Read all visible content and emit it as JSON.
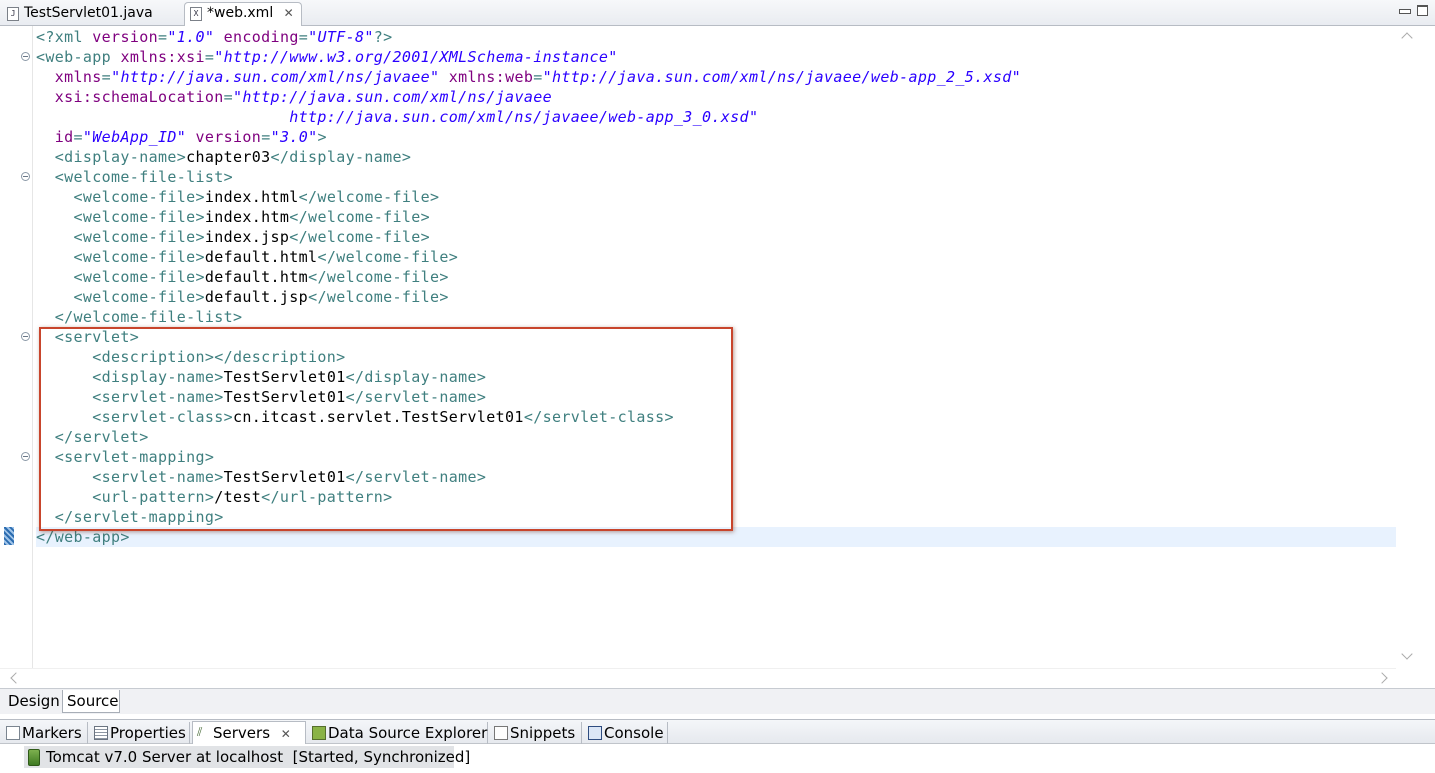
{
  "editor_tabs": [
    {
      "label": "TestServlet01.java",
      "icon": "java-file-icon",
      "active": false
    },
    {
      "label": "*web.xml",
      "icon": "xml-file-icon",
      "active": true,
      "close": "✕"
    }
  ],
  "code_lines": [
    [
      [
        "t",
        "<?xml "
      ],
      [
        "a",
        "version"
      ],
      [
        "t",
        "="
      ],
      [
        "v",
        "\"1.0\""
      ],
      [
        "t",
        " "
      ],
      [
        "a",
        "encoding"
      ],
      [
        "t",
        "="
      ],
      [
        "v",
        "\"UTF-8\""
      ],
      [
        "t",
        "?>"
      ]
    ],
    [
      [
        "t",
        "<web-app "
      ],
      [
        "a",
        "xmlns:xsi"
      ],
      [
        "t",
        "="
      ],
      [
        "v",
        "\"http://www.w3.org/2001/XMLSchema-instance\""
      ]
    ],
    [
      [
        "t",
        "  "
      ],
      [
        "a",
        "xmlns"
      ],
      [
        "t",
        "="
      ],
      [
        "v",
        "\"http://java.sun.com/xml/ns/javaee\""
      ],
      [
        "t",
        " "
      ],
      [
        "a",
        "xmlns:web"
      ],
      [
        "t",
        "="
      ],
      [
        "v",
        "\"http://java.sun.com/xml/ns/javaee/web-app_2_5.xsd\""
      ]
    ],
    [
      [
        "t",
        "  "
      ],
      [
        "a",
        "xsi:schemaLocation"
      ],
      [
        "t",
        "="
      ],
      [
        "v",
        "\"http://java.sun.com/xml/ns/javaee"
      ]
    ],
    [
      [
        "t",
        "                           "
      ],
      [
        "v",
        "http://java.sun.com/xml/ns/javaee/web-app_3_0.xsd\""
      ]
    ],
    [
      [
        "t",
        "  "
      ],
      [
        "a",
        "id"
      ],
      [
        "t",
        "="
      ],
      [
        "v",
        "\"WebApp_ID\""
      ],
      [
        "t",
        " "
      ],
      [
        "a",
        "version"
      ],
      [
        "t",
        "="
      ],
      [
        "v",
        "\"3.0\""
      ],
      [
        "t",
        ">"
      ]
    ],
    [
      [
        "t",
        "  <display-name>"
      ],
      [
        "x",
        "chapter03"
      ],
      [
        "t",
        "</display-name>"
      ]
    ],
    [
      [
        "t",
        "  <welcome-file-list>"
      ]
    ],
    [
      [
        "t",
        "    <welcome-file>"
      ],
      [
        "x",
        "index.html"
      ],
      [
        "t",
        "</welcome-file>"
      ]
    ],
    [
      [
        "t",
        "    <welcome-file>"
      ],
      [
        "x",
        "index.htm"
      ],
      [
        "t",
        "</welcome-file>"
      ]
    ],
    [
      [
        "t",
        "    <welcome-file>"
      ],
      [
        "x",
        "index.jsp"
      ],
      [
        "t",
        "</welcome-file>"
      ]
    ],
    [
      [
        "t",
        "    <welcome-file>"
      ],
      [
        "x",
        "default.html"
      ],
      [
        "t",
        "</welcome-file>"
      ]
    ],
    [
      [
        "t",
        "    <welcome-file>"
      ],
      [
        "x",
        "default.htm"
      ],
      [
        "t",
        "</welcome-file>"
      ]
    ],
    [
      [
        "t",
        "    <welcome-file>"
      ],
      [
        "x",
        "default.jsp"
      ],
      [
        "t",
        "</welcome-file>"
      ]
    ],
    [
      [
        "t",
        "  </welcome-file-list>"
      ]
    ],
    [
      [
        "t",
        "  <servlet>"
      ]
    ],
    [
      [
        "t",
        "      <description></description>"
      ]
    ],
    [
      [
        "t",
        "      <display-name>"
      ],
      [
        "x",
        "TestServlet01"
      ],
      [
        "t",
        "</display-name>"
      ]
    ],
    [
      [
        "t",
        "      <servlet-name>"
      ],
      [
        "x",
        "TestServlet01"
      ],
      [
        "t",
        "</servlet-name>"
      ]
    ],
    [
      [
        "t",
        "      <servlet-class>"
      ],
      [
        "x",
        "cn.itcast.servlet.TestServlet01"
      ],
      [
        "t",
        "</servlet-class>"
      ]
    ],
    [
      [
        "t",
        "  </servlet>"
      ]
    ],
    [
      [
        "t",
        "  <servlet-mapping>"
      ]
    ],
    [
      [
        "t",
        "      <servlet-name>"
      ],
      [
        "x",
        "TestServlet01"
      ],
      [
        "t",
        "</servlet-name>"
      ]
    ],
    [
      [
        "t",
        "      <url-pattern>"
      ],
      [
        "x",
        "/test"
      ],
      [
        "t",
        "</url-pattern>"
      ]
    ],
    [
      [
        "t",
        "  </servlet-mapping>"
      ]
    ],
    [
      [
        "t",
        "</web-app>"
      ]
    ]
  ],
  "fold_lines": [
    1,
    7,
    15,
    21
  ],
  "current_line": 25,
  "page_tabs": {
    "design": "Design",
    "source": "Source"
  },
  "views": {
    "markers": "Markers",
    "properties": "Properties",
    "servers": "Servers",
    "servers_close": "✕",
    "data_source_explorer": "Data Source Explorer",
    "snippets": "Snippets",
    "console": "Console"
  },
  "server": {
    "name": "Tomcat v7.0 Server at localhost",
    "status": "[Started, Synchronized]"
  },
  "colors": {
    "tag": "#3f7f7f",
    "attribute": "#7f007f",
    "value": "#2a00ff",
    "content": "#000000",
    "highlight_box": "#c8452c",
    "current_line": "#e8f2fe"
  }
}
